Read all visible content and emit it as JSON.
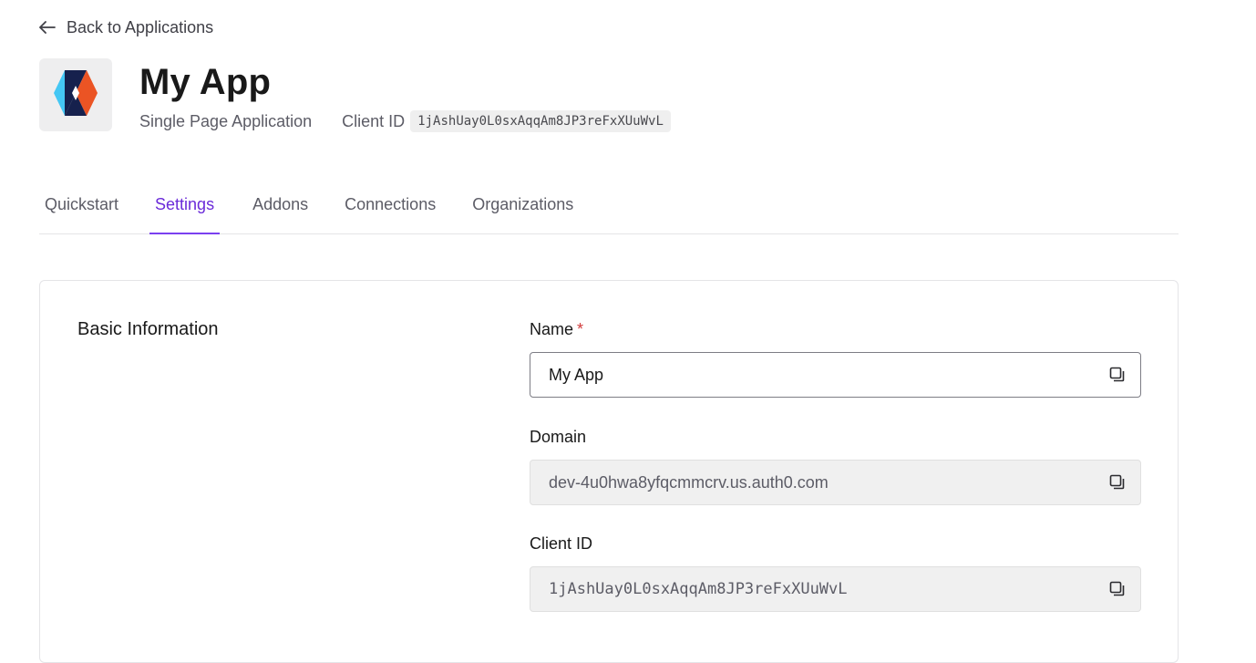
{
  "nav": {
    "back_label": "Back to Applications",
    "back_icon": "arrow-left-icon"
  },
  "app": {
    "name": "My App",
    "type": "Single Page Application",
    "client_id_label": "Client ID",
    "client_id": "1jAshUay0L0sxAqqAm8JP3reFxXUuWvL",
    "logo_icon": "app-logo-icon"
  },
  "tabs": [
    {
      "label": "Quickstart",
      "active": false
    },
    {
      "label": "Settings",
      "active": true
    },
    {
      "label": "Addons",
      "active": false
    },
    {
      "label": "Connections",
      "active": false
    },
    {
      "label": "Organizations",
      "active": false
    }
  ],
  "basic_info": {
    "title": "Basic Information",
    "fields": {
      "name": {
        "label": "Name",
        "required_mark": "*",
        "value": "My App"
      },
      "domain": {
        "label": "Domain",
        "value": "dev-4u0hwa8yfqcmmcrv.us.auth0.com"
      },
      "client_id": {
        "label": "Client ID",
        "value": "1jAshUay0L0sxAqqAm8JP3reFxXUuWvL"
      }
    }
  },
  "colors": {
    "accent": "#6b2bd9",
    "required": "#d23c3c",
    "logo_blue": "#44c7f4",
    "logo_orange": "#eb5424",
    "logo_navy": "#16214d"
  }
}
